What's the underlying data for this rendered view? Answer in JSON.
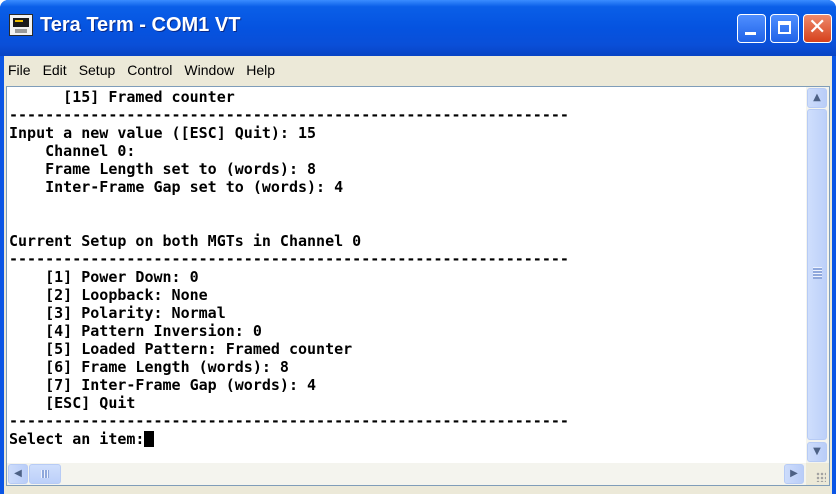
{
  "window": {
    "title": "Tera Term - COM1 VT",
    "app_icon": "tera-term-icon",
    "controls": [
      "minimize-icon",
      "maximize-icon",
      "close-icon"
    ],
    "close_glyph": "✕"
  },
  "menu": [
    "File",
    "Edit",
    "Setup",
    "Control",
    "Window",
    "Help"
  ],
  "terminal": {
    "lines": [
      "      [15] Framed counter",
      "--------------------------------------------------------------",
      "Input a new value ([ESC] Quit): 15",
      "    Channel 0:",
      "    Frame Length set to (words): 8",
      "    Inter-Frame Gap set to (words): 4",
      "",
      "",
      "Current Setup on both MGTs in Channel 0",
      "--------------------------------------------------------------",
      "    [1] Power Down: 0",
      "    [2] Loopback: None",
      "    [3] Polarity: Normal",
      "    [4] Pattern Inversion: 0",
      "    [5] Loaded Pattern: Framed counter",
      "    [6] Frame Length (words): 8",
      "    [7] Inter-Frame Gap (words): 4",
      "    [ESC] Quit",
      "--------------------------------------------------------------",
      "Select an item:"
    ]
  },
  "scrollbars": {
    "up_arrow": "▲",
    "down_arrow": "▼",
    "left_arrow": "◀",
    "right_arrow": "▶"
  },
  "colors": {
    "titlebar": "#0553e0",
    "close_button": "#d6411c",
    "terminal_bg": "#ffffff",
    "terminal_fg": "#000000"
  }
}
